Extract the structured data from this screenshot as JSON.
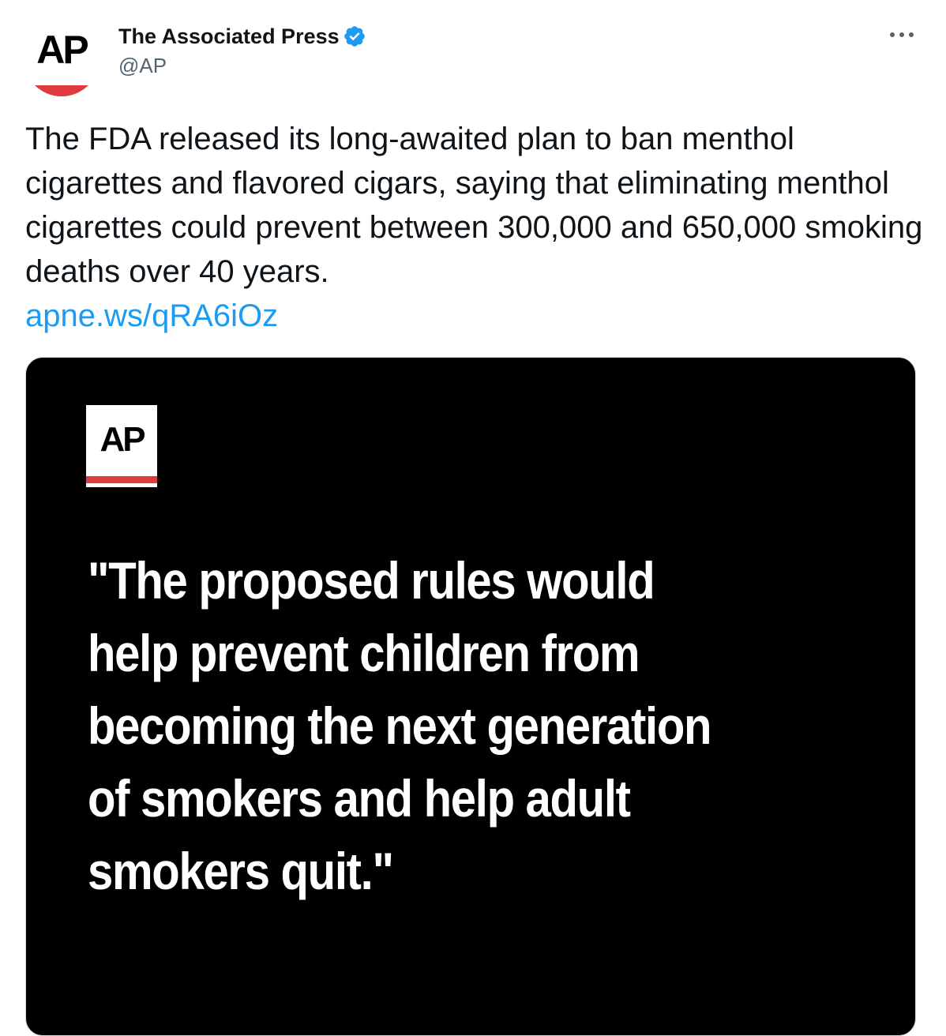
{
  "author": {
    "display_name": "The Associated Press",
    "handle": "@AP",
    "verified": true,
    "avatar_logo_text": "AP",
    "avatar_icon": "ap-logo-icon",
    "verified_icon": "verified-badge-icon"
  },
  "more_icon": "more-options-icon",
  "tweet": {
    "text": "The FDA released its long-awaited plan to ban menthol cigarettes and flavored cigars, saying that eliminating menthol cigarettes could prevent between 300,000 and 650,000 smoking deaths over 40 years.",
    "link": "apne.ws/qRA6iOz"
  },
  "media": {
    "logo_text": "AP",
    "quote": "\"The proposed rules would help prevent children from becoming the next generation of smokers and help adult smokers quit.\""
  },
  "colors": {
    "link": "#1d9bf0",
    "verified": "#1d9bf0",
    "ap_red": "#e03a3e",
    "card_background": "#000000",
    "secondary_text": "#536471"
  }
}
